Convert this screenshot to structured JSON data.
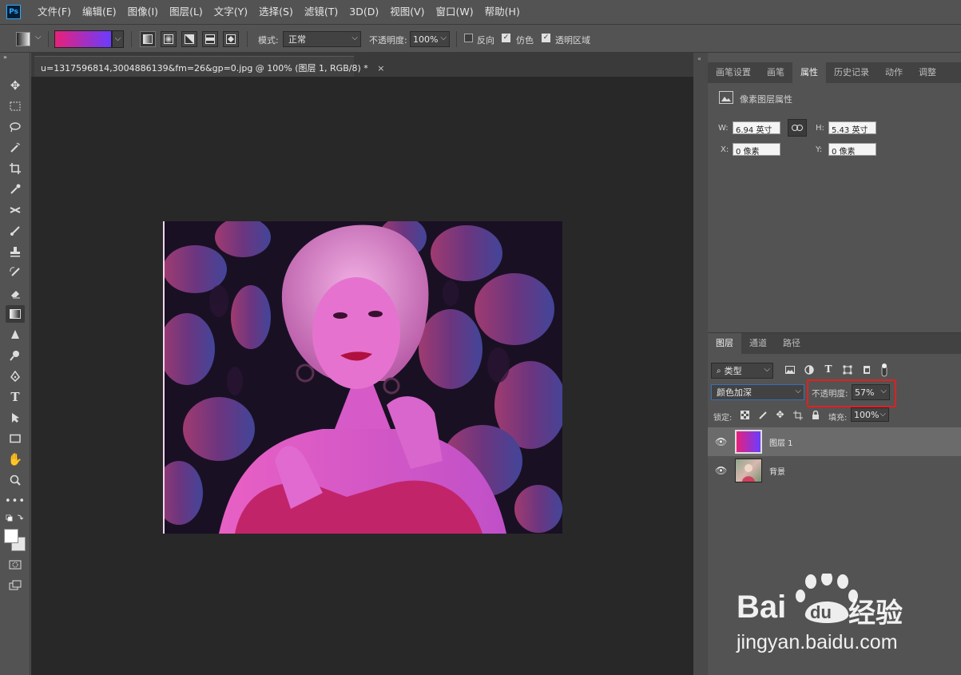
{
  "menubar": {
    "logo": "Ps",
    "items": [
      "文件(F)",
      "编辑(E)",
      "图像(I)",
      "图层(L)",
      "文字(Y)",
      "选择(S)",
      "滤镜(T)",
      "3D(D)",
      "视图(V)",
      "窗口(W)",
      "帮助(H)"
    ]
  },
  "options": {
    "mode_label": "模式:",
    "mode_value": "正常",
    "opacity_label": "不透明度:",
    "opacity_value": "100%",
    "reverse_label": "反向",
    "reverse_checked": false,
    "dither_label": "仿色",
    "dither_checked": true,
    "transparency_label": "透明区域",
    "transparency_checked": true,
    "gradient_colors": [
      "#e8207a",
      "#6a3cff"
    ]
  },
  "document": {
    "tab_title": "u=1317596814,3004886139&fm=26&gp=0.jpg @ 100% (图层 1, RGB/8) *",
    "tab_close": "×"
  },
  "properties_panel": {
    "tabs": [
      "画笔设置",
      "画笔",
      "属性",
      "历史记录",
      "动作",
      "调整"
    ],
    "active_tab": 2,
    "section_title": "像素图层属性",
    "w_label": "W:",
    "w_value": "6.94 英寸",
    "h_label": "H:",
    "h_value": "5.43 英寸",
    "x_label": "X:",
    "x_value": "0 像素",
    "y_label": "Y:",
    "y_value": "0 像素"
  },
  "layers_panel": {
    "tabs": [
      "图层",
      "通道",
      "路径"
    ],
    "active_tab": 0,
    "filter_kind": "类型",
    "blend_mode": "颜色加深",
    "opacity_label": "不透明度:",
    "opacity_value": "57%",
    "lock_label": "锁定:",
    "fill_label": "填充:",
    "fill_value": "100%",
    "layers": [
      {
        "name": "图层 1",
        "selected": true
      },
      {
        "name": "背景",
        "selected": false
      }
    ]
  },
  "watermark": {
    "brand": "Bai",
    "brand_du": "du",
    "brand_cn": "经验",
    "url": "jingyan.baidu.com"
  }
}
